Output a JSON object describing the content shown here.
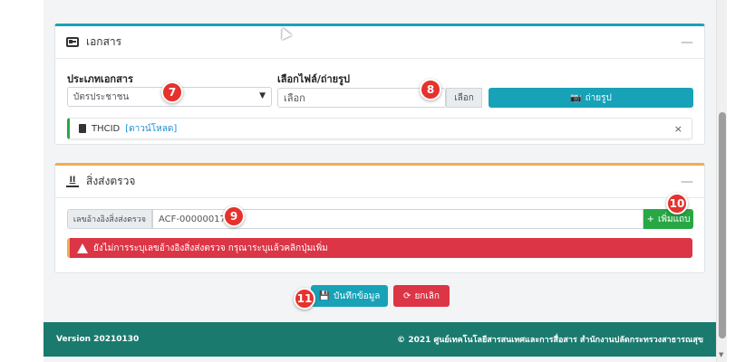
{
  "documents": {
    "title": "เอกสาร",
    "type_label": "ประเภทเอกสาร",
    "type_value": "บัตรประชาชน",
    "file_label": "เลือกไฟล์/ถ่ายรูป",
    "file_placeholder": "เลือก",
    "browse_label": "เลือก",
    "camera_label": "ถ่ายรูป",
    "file_name": "THCID",
    "download_link": "[ดาวน์โหลด]",
    "remove_symbol": "×"
  },
  "referral": {
    "title": "สิ่งส่งตรวจ",
    "ref_addon": "เลขอ้างอิงสิ่งส่งตรวจ",
    "ref_value": "ACF-00000017",
    "add_label": "เพิ่มแถบ",
    "alert_text": "ยังไม่การระบุเลขอ้างอิงสิ่งส่งตรวจ กรุณาระบุแล้วคลิกปุ่มเพิ่ม"
  },
  "actions": {
    "save_label": "บันทึกข้อมูล",
    "cancel_label": "ยกเลิก"
  },
  "footer": {
    "version": "Version 20210130",
    "copyright": "2021 ศูนย์เทคโนโลยีสารสนเทศและการสื่อสาร สำนักงานปลัดกระทรวงสาธารณสุข"
  },
  "annotations": [
    "7",
    "8",
    "9",
    "10",
    "11"
  ],
  "colors": {
    "info": "#17a2b8",
    "success": "#28a745",
    "danger": "#dc3545",
    "warning": "#f0ad4e",
    "footer": "#1a7a6e",
    "badge": "#e5322d"
  }
}
